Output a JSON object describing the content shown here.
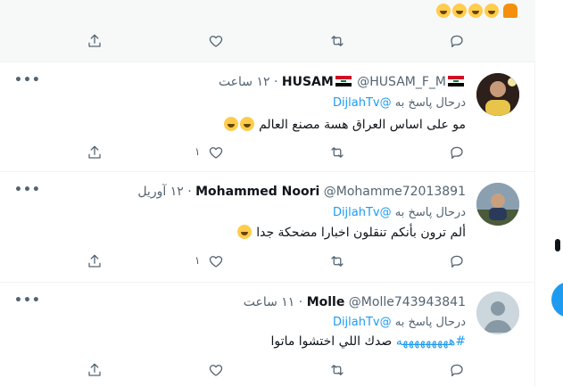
{
  "top_tweet": {
    "text_emoji_count": 4
  },
  "tweets": [
    {
      "name": "HUSAM",
      "handle": "@HUSAM_F_M",
      "time": "١٢ ساعت",
      "reply_prefix": "درحال پاسخ به",
      "reply_to": "@DijlahTv",
      "text": "مو على اساس العراق هسة مصنع العالم",
      "like_count": "١",
      "avatar_icon": "profile-photo"
    },
    {
      "name": "Mohammed Noori",
      "handle": "@Mohamme72013891",
      "time": "١٢ آوریل",
      "reply_prefix": "درحال پاسخ به",
      "reply_to": "@DijlahTv",
      "text": "ألم ترون بأنكم تنقلون اخبارا  مضحكة جدا",
      "like_count": "١",
      "avatar_icon": "profile-photo"
    },
    {
      "name": "Molle",
      "handle": "@Molle743943841",
      "time": "١١ ساعت",
      "reply_prefix": "درحال پاسخ به",
      "reply_to": "@DijlahTv",
      "hashtag": "#هههههههههه",
      "text": "صدك اللي اختشوا ماتوا",
      "like_count": "",
      "avatar_icon": "default-avatar"
    }
  ],
  "colors": {
    "accent": "#1d9bf0",
    "text_primary": "#0f1419",
    "text_secondary": "#536471",
    "divider": "#eff3f4"
  }
}
